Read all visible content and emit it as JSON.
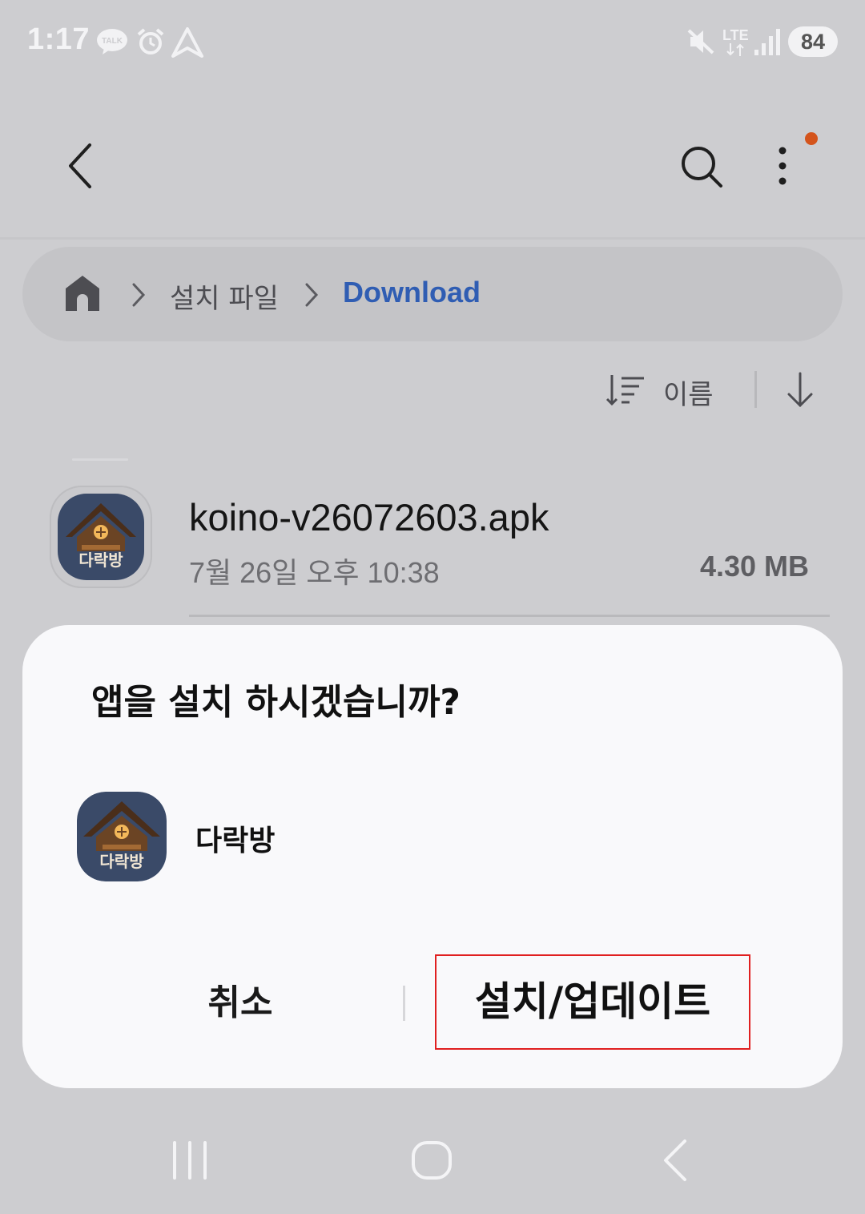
{
  "status_bar": {
    "time": "1:17",
    "network": "LTE",
    "battery": "84",
    "icons": [
      "kakaotalk-icon",
      "alarm-icon",
      "navigation-icon",
      "mute-icon",
      "signal-icon"
    ]
  },
  "app_bar": {
    "icons": [
      "back-icon",
      "search-icon",
      "more-options-icon"
    ],
    "notification_dot_color": "#d4541c"
  },
  "breadcrumb": {
    "items": [
      "설치 파일",
      "Download"
    ],
    "active_color": "#2f5db3"
  },
  "sort": {
    "label": "이름"
  },
  "file": {
    "name": "koino-v26072603.apk",
    "date": "7월 26일 오후 10:38",
    "size": "4.30 MB"
  },
  "dialog": {
    "title": "앱을 설치 하시겠습니까?",
    "app_name": "다락방",
    "app_icon_text": "다락방",
    "cancel_label": "취소",
    "install_label": "설치/업데이트",
    "highlight_color": "#e02020"
  }
}
